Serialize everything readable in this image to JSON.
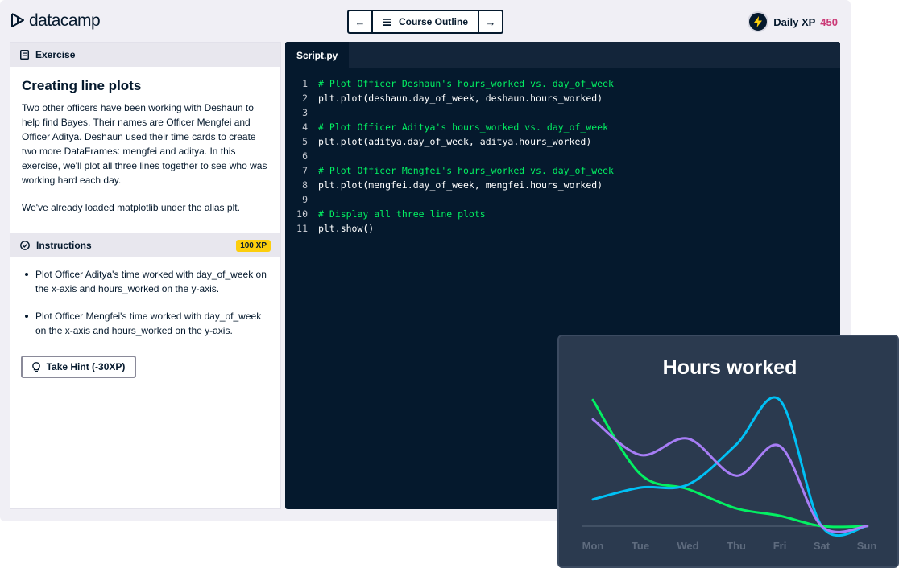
{
  "brand": {
    "name": "datacamp"
  },
  "nav": {
    "prev_icon": "arrow-left-icon",
    "outline_label": "Course Outline",
    "next_icon": "arrow-right-icon"
  },
  "xp": {
    "label": "Daily XP",
    "value": "450"
  },
  "exercise": {
    "header": "Exercise",
    "title": "Creating line plots",
    "paragraph1": "Two other officers have been working with Deshaun to help find Bayes. Their names are Officer Mengfei and Officer Aditya. Deshaun used their time cards to create two more DataFrames: mengfei and aditya. In this exercise, we'll plot all three lines together to see who was working hard each day.",
    "paragraph2": "We've already loaded matplotlib under the alias plt."
  },
  "instructions": {
    "header": "Instructions",
    "xp_badge": "100 XP",
    "items": [
      "Plot Officer Aditya's time worked with day_of_week on the x-axis and hours_worked on the y-axis.",
      "Plot Officer Mengfei's time worked with day_of_week on the x-axis and hours_worked on the y-axis."
    ],
    "hint_label": "Take Hint (-30XP)"
  },
  "editor": {
    "tab": "Script.py",
    "lines": [
      {
        "n": "1",
        "text": "# Plot Officer Deshaun's hours_worked vs. day_of_week",
        "comment": true
      },
      {
        "n": "2",
        "text": "plt.plot(deshaun.day_of_week, deshaun.hours_worked)",
        "comment": false
      },
      {
        "n": "3",
        "text": "",
        "comment": false
      },
      {
        "n": "4",
        "text": "# Plot Officer Aditya's hours_worked vs. day_of_week",
        "comment": true
      },
      {
        "n": "5",
        "text": "plt.plot(aditya.day_of_week, aditya.hours_worked)",
        "comment": false
      },
      {
        "n": "6",
        "text": "",
        "comment": false
      },
      {
        "n": "7",
        "text": "# Plot Officer Mengfei's hours_worked vs. day_of_week",
        "comment": true
      },
      {
        "n": "8",
        "text": "plt.plot(mengfei.day_of_week, mengfei.hours_worked)",
        "comment": false
      },
      {
        "n": "9",
        "text": "",
        "comment": false
      },
      {
        "n": "10",
        "text": "# Display all three line plots",
        "comment": true
      },
      {
        "n": "11",
        "text": "plt.show()",
        "comment": false
      }
    ]
  },
  "colors": {
    "accent_green": "#03ef62",
    "navy": "#05192d",
    "xp_pink": "#cb3976",
    "badge_yellow": "#fcce0d"
  },
  "chart_data": {
    "type": "line",
    "title": "Hours worked",
    "categories": [
      "Mon",
      "Tue",
      "Wed",
      "Thu",
      "Fri",
      "Sat",
      "Sun"
    ],
    "ylim": [
      0,
      9
    ],
    "grid": false,
    "series": [
      {
        "color": "#03ef62",
        "values": [
          8.5,
          3.5,
          2.5,
          1.2,
          0.7,
          0,
          0
        ]
      },
      {
        "color": "#00c0f5",
        "values": [
          1.8,
          2.6,
          2.8,
          5.5,
          8.5,
          0,
          0
        ]
      },
      {
        "color": "#a77df6",
        "values": [
          7.2,
          4.8,
          5.9,
          3.4,
          5.4,
          0,
          0
        ]
      }
    ]
  }
}
